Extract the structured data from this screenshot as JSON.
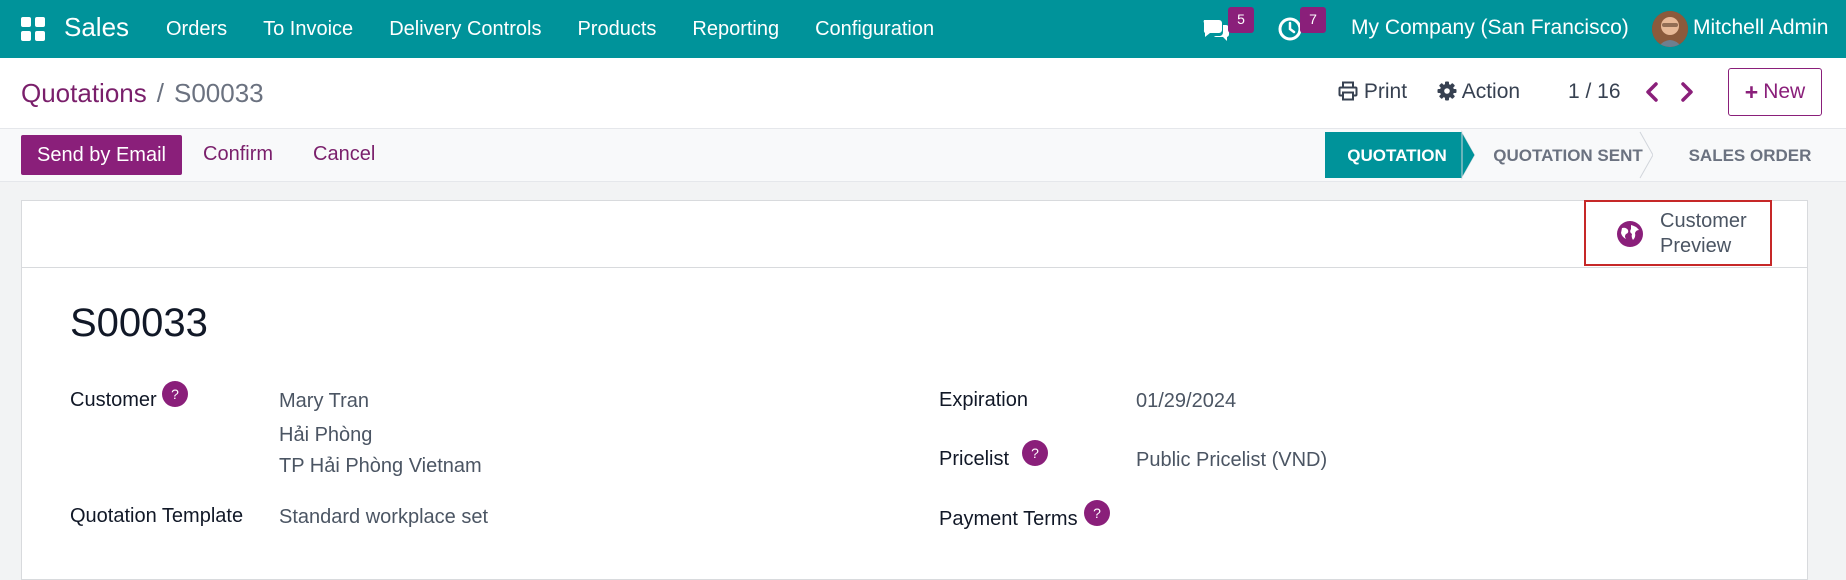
{
  "navbar": {
    "app_name": "Sales",
    "menu": [
      "Orders",
      "To Invoice",
      "Delivery Controls",
      "Products",
      "Reporting",
      "Configuration"
    ],
    "messages_count": "5",
    "activities_count": "7",
    "company": "My Company (San Francisco)",
    "user": "Mitchell Admin",
    "brand_color": "#00939a"
  },
  "breadcrumb": {
    "parent": "Quotations",
    "separator": "/",
    "current": "S00033"
  },
  "control": {
    "print_label": "Print",
    "action_label": "Action",
    "pager": "1 / 16",
    "new_label": "New"
  },
  "statusbar": {
    "buttons": {
      "send_email": "Send by Email",
      "confirm": "Confirm",
      "cancel": "Cancel"
    },
    "stages": [
      "QUOTATION",
      "QUOTATION SENT",
      "SALES ORDER"
    ],
    "active_stage": "QUOTATION",
    "accent_color": "#8a1f7a"
  },
  "smart_button": {
    "line1": "Customer",
    "line2": "Preview",
    "icon": "globe-icon"
  },
  "record": {
    "name": "S00033",
    "fields": {
      "customer_label": "Customer",
      "customer_name": "Mary Tran",
      "customer_city": "Hải Phòng",
      "customer_region": "TP Hải Phòng Vietnam",
      "template_label": "Quotation Template",
      "template_value": "Standard workplace set",
      "expiration_label": "Expiration",
      "expiration_value": "01/29/2024",
      "pricelist_label": "Pricelist",
      "pricelist_value": "Public Pricelist (VND)",
      "payment_terms_label": "Payment Terms",
      "payment_terms_value": ""
    },
    "help_marker": "?"
  }
}
